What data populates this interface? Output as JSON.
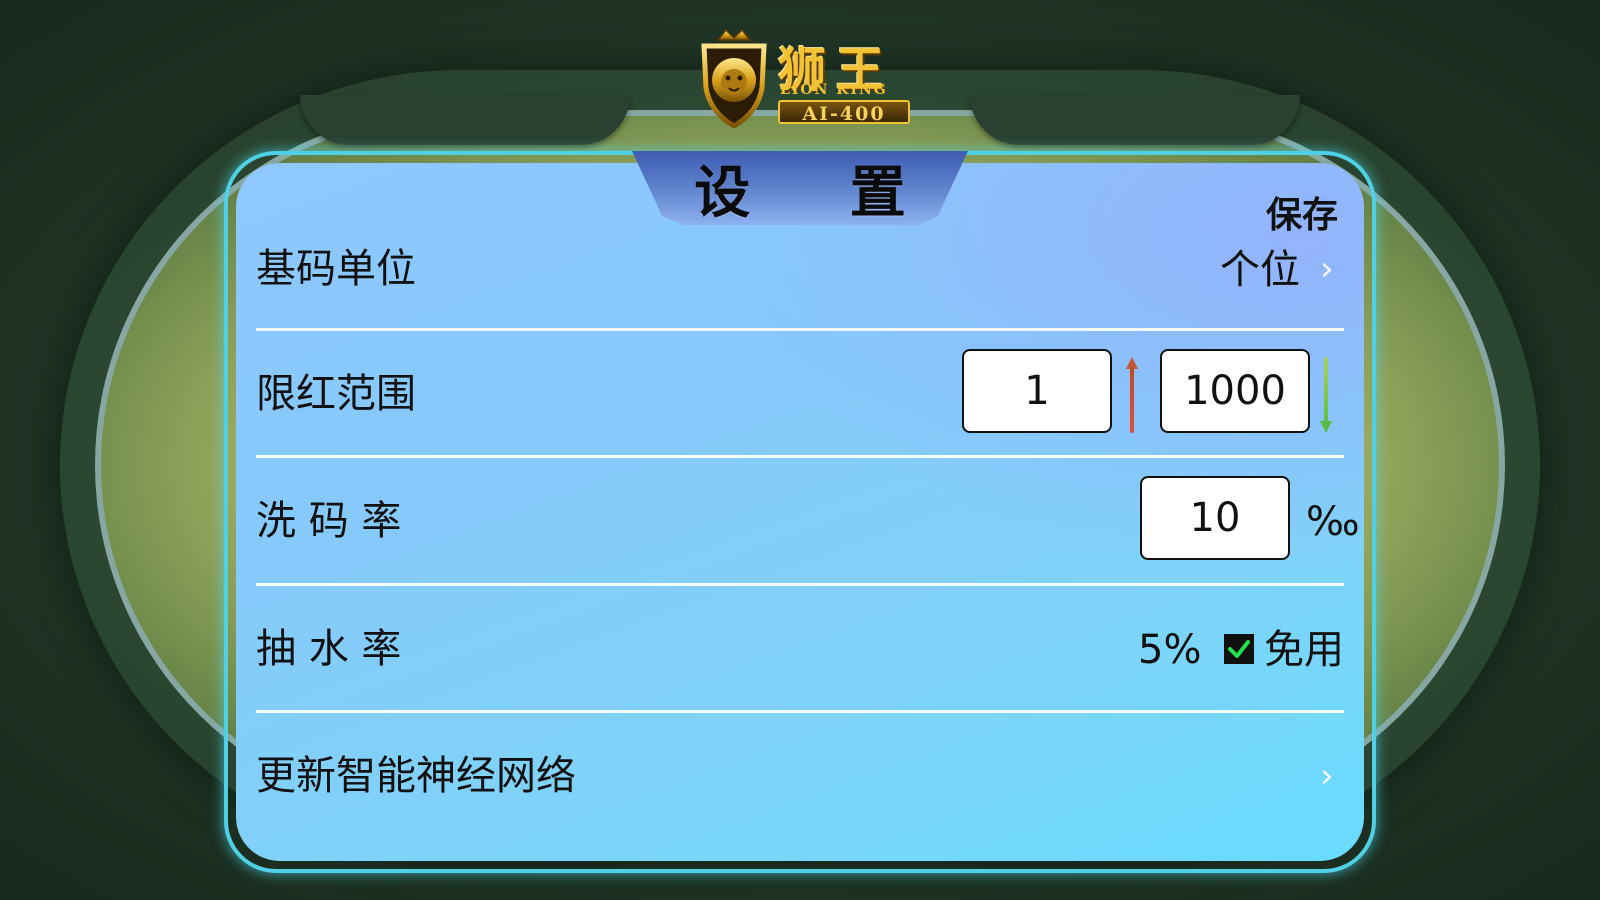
{
  "logo": {
    "name_cn": "狮王",
    "name_en": "LION KING",
    "model": "AI-400",
    "emblem_icon": "lion-crest-icon"
  },
  "dialog": {
    "title": "设 置",
    "save_label": "保存"
  },
  "rows": {
    "chip_unit": {
      "label": "基码单位",
      "value": "个位",
      "chevron_icon": "chevron-right-icon"
    },
    "bet_limit": {
      "label": "限红范围",
      "min": "1",
      "max": "1000",
      "min_icon": "arrow-up-icon",
      "max_icon": "arrow-down-icon"
    },
    "rebate_rate": {
      "label": "洗 码 率",
      "value": "10",
      "unit": "‰"
    },
    "commission_rate": {
      "label": "抽 水 率",
      "value": "5%",
      "waive_label": "免用",
      "waive_checked": true
    },
    "update_network": {
      "label": "更新智能神经网络",
      "chevron_icon": "chevron-right-icon"
    }
  },
  "colors": {
    "panel_border": "#4fd0e4",
    "title_tab": "#3f5bb3",
    "logo_gold": "#f0c234",
    "checkbox_check": "#22e04a",
    "arrow_up": "#c45a34",
    "arrow_down": "#57b946"
  }
}
